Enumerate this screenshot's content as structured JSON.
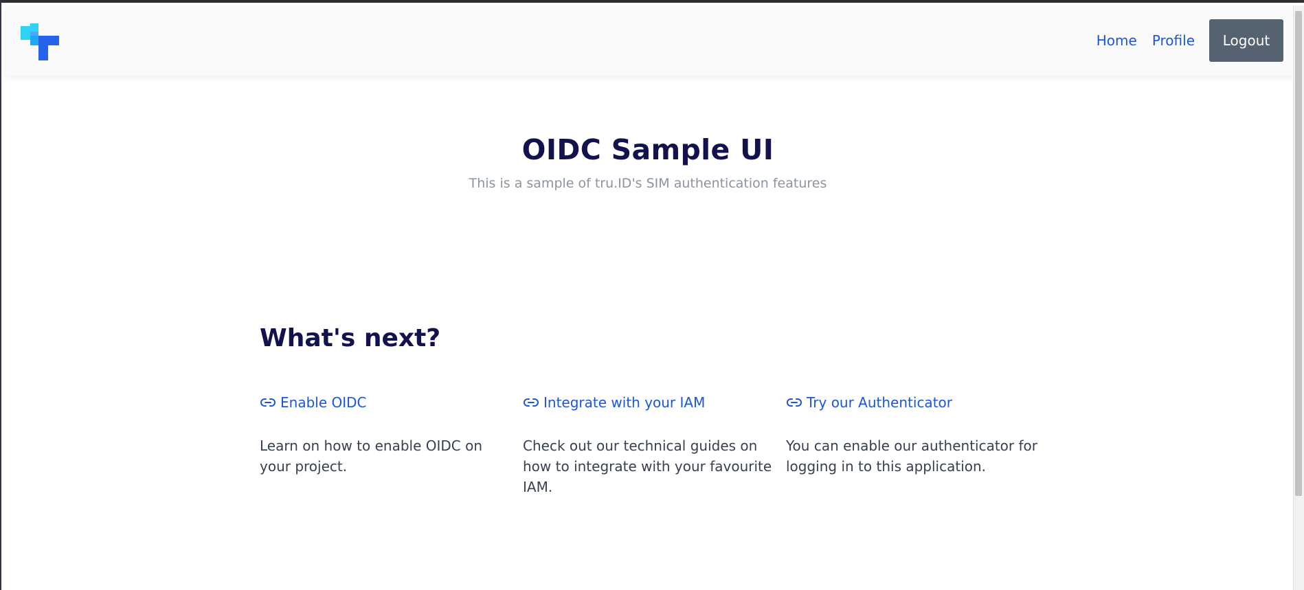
{
  "brand": {
    "logo_icon": "trudi-logo-icon",
    "colors": {
      "cyan": "#33c5f3",
      "blue": "#1f6bff"
    }
  },
  "nav": {
    "home_label": "Home",
    "profile_label": "Profile",
    "logout_label": "Logout"
  },
  "hero": {
    "title": "OIDC Sample UI",
    "subtitle": "This is a sample of tru.ID's SIM authentication features"
  },
  "next": {
    "title": "What's next?",
    "cards": [
      {
        "icon": "link-icon",
        "link": "Enable OIDC",
        "description": "Learn on how to enable OIDC on your project."
      },
      {
        "icon": "link-icon",
        "link": "Integrate with your IAM",
        "description": "Check out our technical guides on how to integrate with your favourite IAM."
      },
      {
        "icon": "link-icon",
        "link": "Try our Authenticator",
        "description": "You can enable our authenticator for logging in to this application."
      }
    ]
  },
  "colors": {
    "accent": "#1a56db",
    "heading": "#12124d",
    "button": "#556270"
  }
}
